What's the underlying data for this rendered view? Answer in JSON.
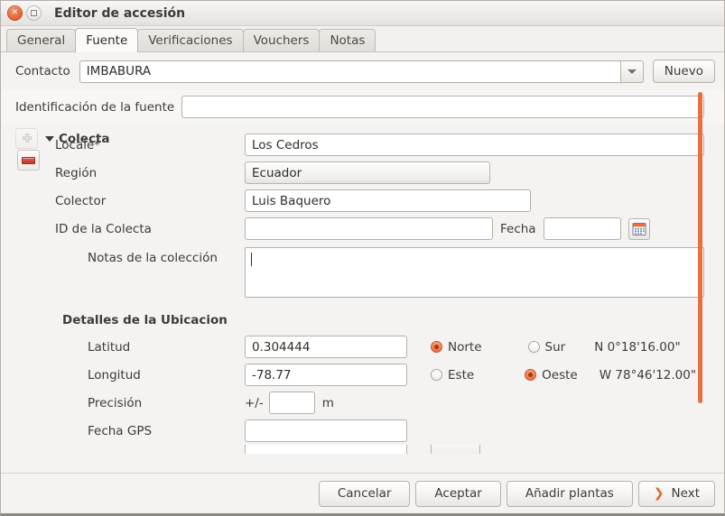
{
  "window": {
    "title": "Editor de accesión",
    "close_icon": "close-icon",
    "maximize_icon": "maximize-icon"
  },
  "tabs": [
    {
      "label": "General",
      "active": false
    },
    {
      "label": "Fuente",
      "active": true
    },
    {
      "label": "Verificaciones",
      "active": false
    },
    {
      "label": "Vouchers",
      "active": false
    },
    {
      "label": "Notas",
      "active": false
    }
  ],
  "contacto": {
    "label": "Contacto",
    "value": "IMBABURA",
    "dropdown_icon": "chevron-down-icon",
    "new_button": "Nuevo"
  },
  "source_id": {
    "label": "Identificación de la fuente",
    "value": ""
  },
  "colecta": {
    "title": "Colecta",
    "expander_icon": "triangle-down-icon",
    "add_icon": "plus-icon",
    "remove_icon": "minus-icon",
    "fields": {
      "locale_label": "Locale*",
      "locale_value": "Los Cedros",
      "region_label": "Región",
      "region_value": "Ecuador",
      "colector_label": "Colector",
      "colector_value": "Luis Baquero",
      "id_colecta_label": "ID de la Colecta",
      "id_colecta_value": "",
      "fecha_label": "Fecha",
      "fecha_value": "",
      "calendar_icon": "calendar-icon",
      "notas_label": "Notas de la colección",
      "notas_value": ""
    }
  },
  "ubicacion": {
    "title": "Detalles de la Ubicacion",
    "latitud_label": "Latitud",
    "latitud_value": "0.304444",
    "longitud_label": "Longitud",
    "longitud_value": "-78.77",
    "precision_label": "Precisión",
    "precision_prefix": "+/-",
    "precision_value": "",
    "precision_unit": "m",
    "fecha_gps_label": "Fecha GPS",
    "fecha_gps_value": "",
    "radios": {
      "norte": "Norte",
      "sur": "Sur",
      "este": "Este",
      "oeste": "Oeste",
      "norte_selected": true,
      "sur_selected": false,
      "este_selected": false,
      "oeste_selected": true
    },
    "lat_dms": "N 0°18'16.00\"",
    "lon_dms": "W 78°46'12.00\""
  },
  "actions": {
    "cancelar": "Cancelar",
    "aceptar": "Aceptar",
    "anadir_plantas": "Añadir plantas",
    "next": "Next",
    "next_icon": "chevron-right-icon"
  },
  "colors": {
    "accent": "#e8703f",
    "scrollbar": "#e8703f",
    "text": "#3c3b37"
  }
}
